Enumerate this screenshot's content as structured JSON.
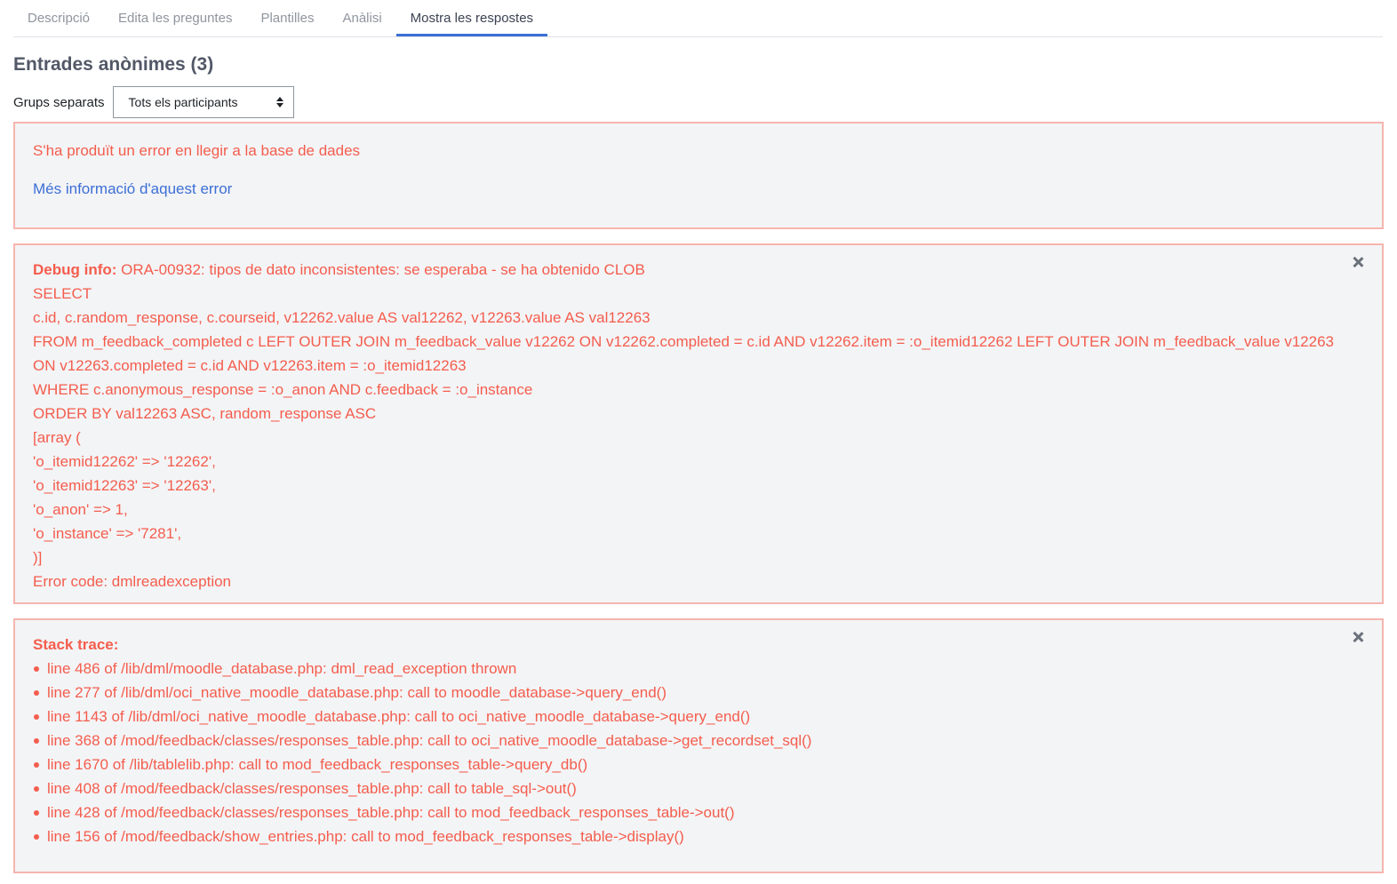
{
  "tabs": [
    {
      "label": "Descripció",
      "active": false
    },
    {
      "label": "Edita les preguntes",
      "active": false
    },
    {
      "label": "Plantilles",
      "active": false
    },
    {
      "label": "Anàlisi",
      "active": false
    },
    {
      "label": "Mostra les respostes",
      "active": true
    }
  ],
  "page_title": "Entrades anònimes (3)",
  "group_selector": {
    "label": "Grups separats",
    "selected": "Tots els participants"
  },
  "error_alert": {
    "message": "S'ha produït un error en llegir a la base de dades",
    "more_info_link": "Més informació d'aquest error"
  },
  "debug_alert": {
    "label": "Debug info:",
    "first_line": "ORA-00932: tipos de dato inconsistentes: se esperaba - se ha obtenido CLOB",
    "lines": [
      "SELECT",
      "c.id, c.random_response, c.courseid, v12262.value AS val12262, v12263.value AS val12263",
      "FROM m_feedback_completed c LEFT OUTER JOIN m_feedback_value v12262 ON v12262.completed = c.id AND v12262.item = :o_itemid12262 LEFT OUTER JOIN m_feedback_value v12263",
      "ON v12263.completed = c.id AND v12263.item = :o_itemid12263",
      "WHERE c.anonymous_response = :o_anon AND c.feedback = :o_instance",
      "ORDER BY val12263 ASC, random_response ASC",
      "[array (",
      "'o_itemid12262' => '12262',",
      "'o_itemid12263' => '12263',",
      "'o_anon' => 1,",
      "'o_instance' => '7281',",
      ")]",
      "Error code: dmlreadexception"
    ],
    "close_icon": "close-icon"
  },
  "stack_alert": {
    "label": "Stack trace:",
    "items": [
      "line 486 of /lib/dml/moodle_database.php: dml_read_exception thrown",
      "line 277 of /lib/dml/oci_native_moodle_database.php: call to moodle_database->query_end()",
      "line 1143 of /lib/dml/oci_native_moodle_database.php: call to oci_native_moodle_database->query_end()",
      "line 368 of /mod/feedback/classes/responses_table.php: call to oci_native_moodle_database->get_recordset_sql()",
      "line 1670 of /lib/tablelib.php: call to mod_feedback_responses_table->query_db()",
      "line 408 of /mod/feedback/classes/responses_table.php: call to table_sql->out()",
      "line 428 of /mod/feedback/classes/responses_table.php: call to mod_feedback_responses_table->out()",
      "line 156 of /mod/feedback/show_entries.php: call to mod_feedback_responses_table->display()"
    ],
    "close_icon": "close-icon"
  },
  "colors": {
    "error_text": "#f45d4d",
    "alert_border": "#f6b5ae",
    "alert_bg": "#f3f4f6",
    "link": "#3c6fd6",
    "active_tab_underline": "#3c6fd6"
  }
}
